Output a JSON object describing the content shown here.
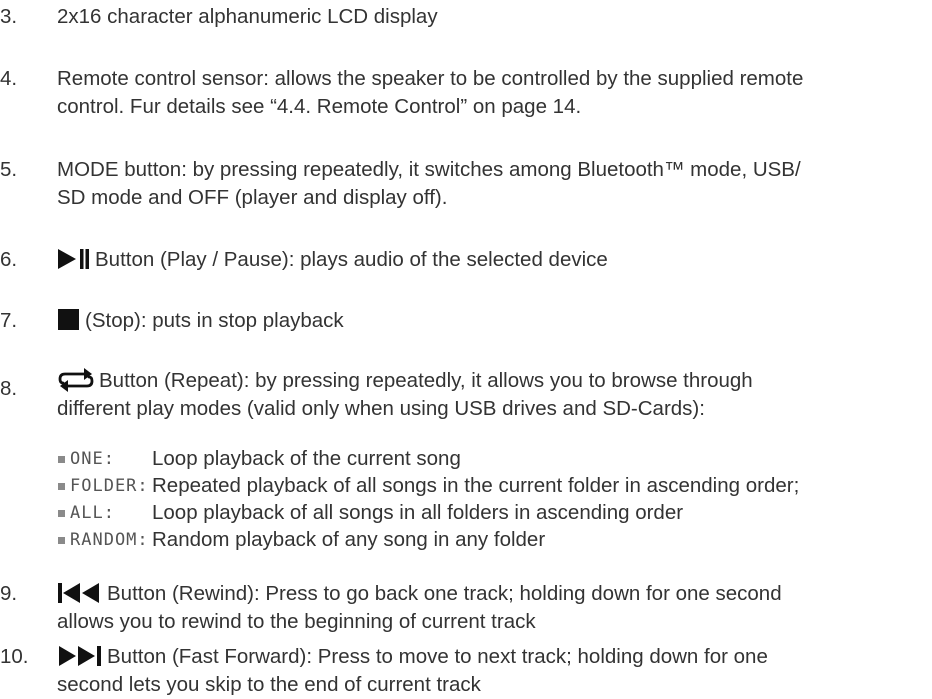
{
  "items": [
    {
      "num": "3.",
      "text": "2x16 character alphanumeric LCD display"
    },
    {
      "num": "4.",
      "line1": "Remote control sensor: allows the speaker to be controlled by the supplied remote",
      "line2": "control. Fur details see “4.4. Remote Control” on page 14."
    },
    {
      "num": "5.",
      "line1": "MODE button: by pressing repeatedly, it switches among Bluetooth™ mode, USB/",
      "line2": "SD mode and OFF (player and display off)."
    },
    {
      "num": "6.",
      "text": "Button (Play / Pause): plays audio of the selected device",
      "icon": "play-pause-icon"
    },
    {
      "num": "7.",
      "text": "(Stop): puts in stop playback",
      "icon": "stop-icon"
    },
    {
      "num": "8.",
      "line1": "Button (Repeat): by pressing repeatedly, it allows you to browse through",
      "line2": "different play modes (valid only when using USB drives and SD-Cards):",
      "icon": "repeat-icon"
    },
    {
      "num": "9.",
      "line1": "Button (Rewind): Press to go back one track; holding down for one second",
      "line2": "allows you to rewind to the beginning of current track",
      "icon": "rewind-icon"
    },
    {
      "num": "10.",
      "line1": "Button (Fast Forward): Press to move to next track; holding down for one",
      "line2": "second lets you skip to the end of current track",
      "icon": "fast-forward-icon"
    }
  ],
  "modes": [
    {
      "label": "ONE:",
      "desc": "Loop playback of the current song"
    },
    {
      "label": "FOLDER:",
      "desc": "Repeated playback of all songs in the current folder in ascending order;"
    },
    {
      "label": "ALL:",
      "desc": "Loop playback of all songs in all folders in ascending order"
    },
    {
      "label": "RANDOM:",
      "desc": "Random playback of any song in any folder"
    }
  ],
  "colors": {
    "text": "#333333",
    "bullet": "#8a8a8a",
    "icon": "#111111"
  }
}
